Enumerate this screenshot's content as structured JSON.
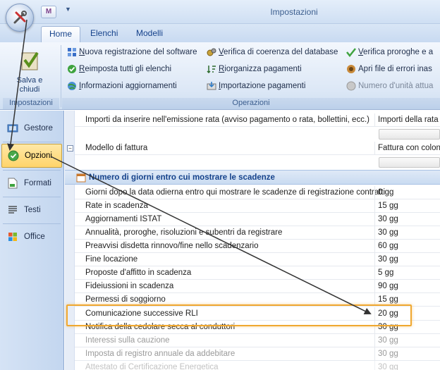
{
  "window": {
    "title": "Impostazioni"
  },
  "tabs": [
    {
      "label": "Home",
      "active": true
    },
    {
      "label": "Elenchi",
      "active": false
    },
    {
      "label": "Modelli",
      "active": false
    }
  ],
  "ribbon": {
    "save": {
      "label_line1": "Salva e",
      "label_line2": "chiudi"
    },
    "group_impostazioni": "Impostazioni",
    "group_operazioni": "Operazioni",
    "items": [
      {
        "label": "Nuova registrazione del software",
        "underline": "N",
        "rest": "uova registrazione del software",
        "icon": "grid-icon"
      },
      {
        "label": "Reimposta tutti gli elenchi",
        "underline": "R",
        "rest": "eimposta tutti gli elenchi",
        "icon": "check-circle-icon"
      },
      {
        "label": "Informazioni aggiornamenti",
        "underline": "I",
        "rest": "nformazioni aggiornamenti",
        "icon": "globe-icon"
      },
      {
        "label": "Verifica di coerenza del database",
        "underline": "V",
        "rest": "erifica di coerenza del database",
        "icon": "gears-icon"
      },
      {
        "label": "Riorganizza pagamenti",
        "underline": "R",
        "rest": "iorganizza pagamenti",
        "icon": "sort-icon"
      },
      {
        "label": "Importazione pagamenti",
        "underline": "I",
        "rest": "mportazione pagamenti",
        "icon": "import-icon"
      },
      {
        "label": "Verifica proroghe e a",
        "underline": "V",
        "rest": "erifica proroghe e a",
        "icon": "checkmark-icon"
      },
      {
        "label": "Apri file di errori inas",
        "underline": "",
        "rest": "Apri file di errori inas",
        "icon": "error-file-icon"
      },
      {
        "label": "Numero d'unità attua",
        "underline": "",
        "rest": "Numero d'unità attua",
        "icon": "disk-icon"
      }
    ]
  },
  "sidebar": {
    "items": [
      {
        "label": "Gestore",
        "icon": "manager-icon",
        "selected": false
      },
      {
        "label": "Opzioni",
        "icon": "options-check-icon",
        "selected": true
      },
      {
        "label": "Formati",
        "icon": "format-icon",
        "selected": false
      },
      {
        "label": "Testi",
        "icon": "text-icon",
        "selected": false
      },
      {
        "label": "Office",
        "icon": "office-icon",
        "selected": false
      }
    ]
  },
  "content": {
    "top_rows": [
      {
        "key": "Importi da inserire nell'emissione rata (avviso pagamento o rata, bollettini, ecc.)",
        "value": "Importi della rata"
      },
      {
        "key": "Modello di fattura",
        "value": "Fattura con colon"
      }
    ],
    "group_title": "Numero di giorni entro cui mostrare le scadenze",
    "rows": [
      {
        "key": "Giorni dopo la data odierna entro qui mostrare le scadenze di registrazione contratti",
        "value": "0 gg"
      },
      {
        "key": "Rate in scadenza",
        "value": "15 gg"
      },
      {
        "key": "Aggiornamenti ISTAT",
        "value": "30 gg"
      },
      {
        "key": "Annualità, proroghe, risoluzioni e subentri da registrare",
        "value": "30 gg"
      },
      {
        "key": "Preavvisi disdetta rinnovo/fine nello scadenzario",
        "value": "60 gg"
      },
      {
        "key": "Fine locazione",
        "value": "30 gg"
      },
      {
        "key": "Proposte d'affitto in scadenza",
        "value": "5 gg"
      },
      {
        "key": "Fideiussioni in scadenza",
        "value": "90 gg"
      },
      {
        "key": "Permessi di soggiorno",
        "value": "15 gg"
      },
      {
        "key": "Comunicazione successive RLI",
        "value": "20 gg"
      },
      {
        "key": "Notifica della cedolare secca al conduttori",
        "value": "30 gg"
      },
      {
        "key": "Interessi sulla cauzione",
        "value": "30 gg"
      },
      {
        "key": "Imposta di registro annuale da addebitare",
        "value": "30 gg"
      },
      {
        "key": "Attestato di Certificazione Energetica",
        "value": "30 gg"
      }
    ]
  },
  "colors": {
    "highlight": "#f0a830",
    "ribbon_text": "#15428b",
    "selected_nav": "#ffd46b"
  }
}
